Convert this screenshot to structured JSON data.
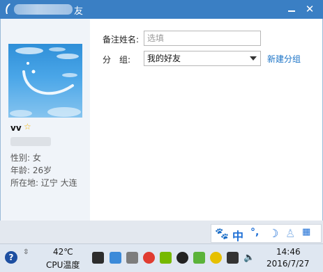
{
  "window": {
    "title_visible": "友"
  },
  "profile": {
    "nickname": "vv",
    "gender_label": "性别: 女",
    "age_label": "年龄: 26岁",
    "location_label": "所在地: 辽宁  大连"
  },
  "form": {
    "remark_label": "备注姓名:",
    "remark_placeholder": "选填",
    "group_label_1": "分",
    "group_label_2": "组:",
    "group_selected": "我的好友",
    "new_group_link": "新建分组"
  },
  "ime": {
    "mode": "中",
    "punct": "°,"
  },
  "taskbar": {
    "temperature": "42℃",
    "cpu_label": "CPU温度",
    "time": "14:46",
    "date": "2016/7/27"
  },
  "colors": {
    "titlebar": "#3a7fc4",
    "link": "#1a73c7",
    "star": "#f4b400"
  }
}
